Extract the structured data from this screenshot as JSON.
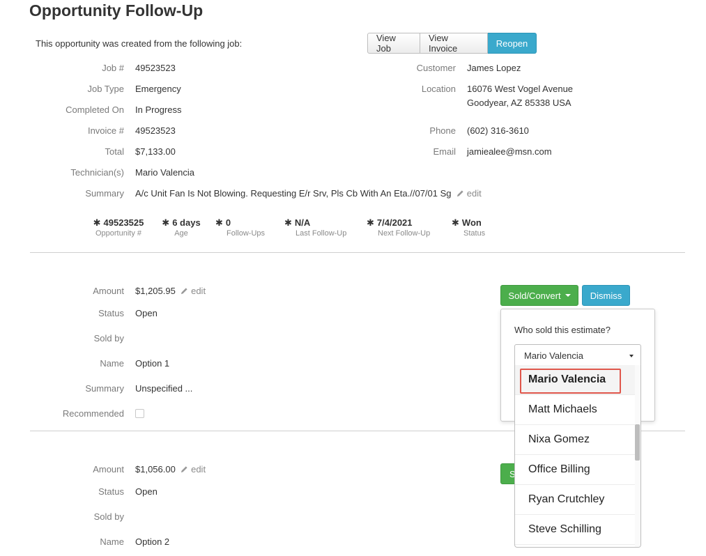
{
  "page": {
    "title": "Opportunity Follow-Up",
    "intro": "This opportunity was created from the following job:"
  },
  "actions": {
    "view_job": "View Job",
    "view_invoice": "View Invoice",
    "reopen": "Reopen"
  },
  "job": {
    "job_num_label": "Job #",
    "job_num": "49523523",
    "job_type_label": "Job Type",
    "job_type": "Emergency",
    "completed_label": "Completed On",
    "completed": "In Progress",
    "invoice_label": "Invoice #",
    "invoice": "49523523",
    "total_label": "Total",
    "total": "$7,133.00",
    "tech_label": "Technician(s)",
    "tech": "Mario Valencia",
    "summary_label": "Summary",
    "summary": "A/c Unit Fan Is Not Blowing. Requesting E/r Srv, Pls Cb With An Eta.//07/01 Sg",
    "edit": "edit"
  },
  "customer": {
    "customer_label": "Customer",
    "customer": "James Lopez",
    "location_label": "Location",
    "address1": "16076 West Vogel Avenue",
    "address2": "Goodyear, AZ 85338 USA",
    "phone_label": "Phone",
    "phone": "(602) 316-3610",
    "email_label": "Email",
    "email": "jamiealee@msn.com"
  },
  "stats": [
    {
      "value": "49523525",
      "label": "Opportunity #"
    },
    {
      "value": "6 days",
      "label": "Age"
    },
    {
      "value": "0",
      "label": "Follow-Ups"
    },
    {
      "value": "N/A",
      "label": "Last Follow-Up"
    },
    {
      "value": "7/4/2021",
      "label": "Next Follow-Up"
    },
    {
      "value": "Won",
      "label": "Status"
    }
  ],
  "estimate1": {
    "amount_label": "Amount",
    "amount": "$1,205.95",
    "status_label": "Status",
    "status": "Open",
    "soldby_label": "Sold by",
    "name_label": "Name",
    "name": "Option 1",
    "summary_label": "Summary",
    "summary": "Unspecified ...",
    "recommended_label": "Recommended",
    "sold_convert": "Sold/Convert",
    "dismiss": "Dismiss"
  },
  "estimate2": {
    "amount_label": "Amount",
    "amount": "$1,056.00",
    "status_label": "Status",
    "status": "Open",
    "soldby_label": "Sold by",
    "name_label": "Name",
    "name": "Option 2",
    "button_partial": "S"
  },
  "popover": {
    "question": "Who sold this estimate?",
    "selected": "Mario Valencia",
    "options": [
      "Mario Valencia",
      "Matt Michaels",
      "Nixa Gomez",
      "Office Billing",
      "Ryan Crutchley",
      "Steve Schilling"
    ]
  },
  "colors": {
    "primary_blue": "#3aa9cc",
    "success_green": "#4cae4c",
    "highlight_red": "#e0564b"
  }
}
